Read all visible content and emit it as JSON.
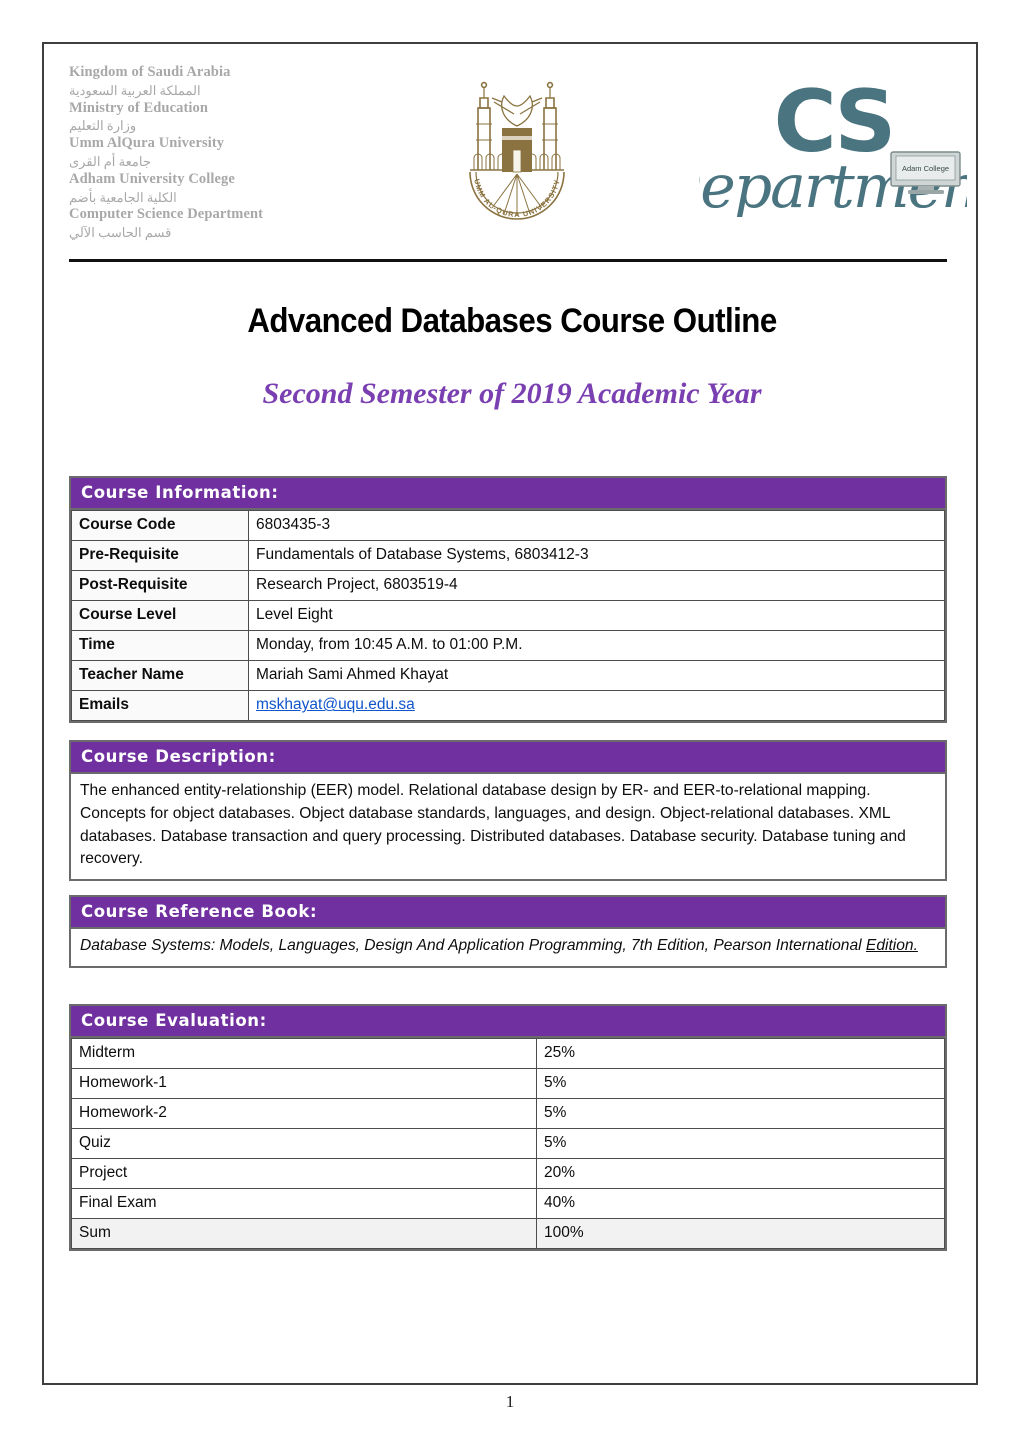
{
  "letterhead": {
    "lines": [
      {
        "en": "Kingdom of Saudi Arabia",
        "ar": "المملكة العربية السعودية"
      },
      {
        "en": "Ministry of Education",
        "ar": "وزارة التعليم"
      },
      {
        "en": "Umm AlQura University",
        "ar": "جامعة أم القرى"
      },
      {
        "en": "Adham University College",
        "ar": "الكلية الجامعية بأضم"
      },
      {
        "en": "Computer Science Department",
        "ar": "قسم الحاسب الآلي"
      }
    ],
    "uqu_logo_caption": "UMM AL-QURA UNIVERSITY",
    "cs_logo": {
      "line1": "CS",
      "line2": "Department",
      "monitor_label": "Adam College",
      "color": "#4a7480"
    }
  },
  "title": "Advanced Databases Course Outline",
  "subtitle": "Second Semester of 2019 Academic Year",
  "colors": {
    "header_purple": "#7030a0",
    "label_purple": "#7030a0",
    "subtitle_purple": "#7a3fb0",
    "link_blue": "#1155cc",
    "sum_row_gray": "#f2f2f2"
  },
  "course_information": {
    "header": "Course Information:",
    "rows": [
      {
        "label": "Course Code",
        "value": "6803435-3"
      },
      {
        "label": "Pre-Requisite",
        "value": "Fundamentals of Database Systems, 6803412-3"
      },
      {
        "label": "Post-Requisite",
        "value": "Research Project, 6803519-4"
      },
      {
        "label": "Course Level",
        "value": "Level Eight"
      },
      {
        "label": "Time",
        "value": "Monday, from 10:45 A.M. to 01:00 P.M."
      },
      {
        "label": "Teacher Name",
        "value": "Mariah Sami Ahmed Khayat"
      },
      {
        "label": "Emails",
        "value": "mskhayat@uqu.edu.sa"
      }
    ]
  },
  "course_description": {
    "header": "Course Description:",
    "body": "The enhanced entity-relationship (EER) model. Relational database design by ER- and EER-to-relational mapping. Concepts for object databases. Object database standards, languages, and design. Object-relational databases. XML databases. Database transaction and query processing. Distributed databases. Database security. Database tuning and recovery."
  },
  "course_reference_book": {
    "header": "Course Reference Book:",
    "body_main": "Database Systems: Models, Languages, Design And Application Programming, 7th Edition, Pearson International ",
    "body_underlined": "Edition."
  },
  "course_evaluation": {
    "header": "Course Evaluation:",
    "rows": [
      {
        "item": "Midterm",
        "percent": "25%"
      },
      {
        "item": "Homework-1",
        "percent": "5%"
      },
      {
        "item": "Homework-2",
        "percent": "5%"
      },
      {
        "item": "Quiz",
        "percent": "5%"
      },
      {
        "item": "Project",
        "percent": "20%"
      },
      {
        "item": "Final Exam",
        "percent": "40%"
      },
      {
        "item": "Sum",
        "percent": "100%"
      }
    ]
  },
  "footer": {
    "page_number": "1"
  }
}
